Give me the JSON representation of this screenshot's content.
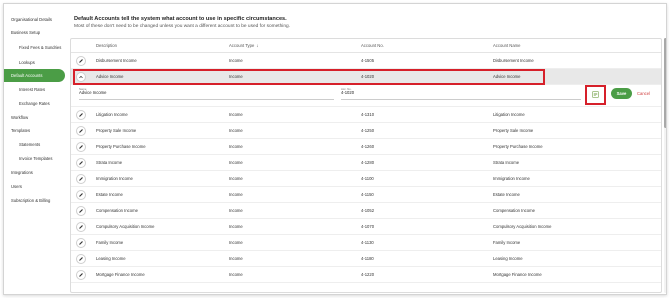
{
  "sidebar": {
    "items": [
      {
        "label": "Organisational Details",
        "level": "top",
        "active": false
      },
      {
        "label": "Business Setup",
        "level": "top",
        "active": false
      },
      {
        "label": "Fixed Fees & Sundries",
        "level": "sub",
        "active": false
      },
      {
        "label": "Lookups",
        "level": "sub",
        "active": false
      },
      {
        "label": "Default Accounts",
        "level": "top",
        "active": true
      },
      {
        "label": "Interest Rates",
        "level": "sub",
        "active": false
      },
      {
        "label": "Exchange Rates",
        "level": "sub",
        "active": false
      },
      {
        "label": "Workflow",
        "level": "top",
        "active": false
      },
      {
        "label": "Templates",
        "level": "top",
        "active": false
      },
      {
        "label": "Statements",
        "level": "sub",
        "active": false
      },
      {
        "label": "Invoice Templates",
        "level": "sub",
        "active": false
      },
      {
        "label": "Integrations",
        "level": "top",
        "active": false
      },
      {
        "label": "Users",
        "level": "top",
        "active": false
      },
      {
        "label": "Subscription & Billing",
        "level": "top",
        "active": false
      }
    ]
  },
  "intro": {
    "line1": "Default Accounts tell the system what account to use in specific circumstances.",
    "line2": "Most of these don't need to be changed unless you want a different account to be used for something."
  },
  "table": {
    "headers": {
      "description": "Description",
      "account_type": "Account Type",
      "sort_glyph": "↓",
      "account_no": "Account No.",
      "account_name": "Account Name"
    },
    "rows_before": [
      {
        "description": "Disbursement Income",
        "type": "Income",
        "no": "4-1505",
        "name": "Disbursement Income"
      }
    ],
    "expanded_row": {
      "description": "Advice Income",
      "type": "Income",
      "no": "4-1020",
      "name": "Advice Income"
    },
    "edit": {
      "name_label": "Name",
      "name_value": "Advice Income",
      "acc_label": "Acc. No.",
      "acc_value": "4-1020",
      "save_label": "Save",
      "cancel_label": "Cancel"
    },
    "rows_after": [
      {
        "description": "Litigation Income",
        "type": "Income",
        "no": "4-1310",
        "name": "Litigation Income"
      },
      {
        "description": "Property Sale Income",
        "type": "Income",
        "no": "4-1250",
        "name": "Property Sale Income"
      },
      {
        "description": "Property Purchase Income",
        "type": "Income",
        "no": "4-1260",
        "name": "Property Purchase Income"
      },
      {
        "description": "Strata Income",
        "type": "Income",
        "no": "4-1280",
        "name": "Strata Income"
      },
      {
        "description": "Immigration Income",
        "type": "Income",
        "no": "4-1100",
        "name": "Immigration Income"
      },
      {
        "description": "Estate Income",
        "type": "Income",
        "no": "4-1150",
        "name": "Estate Income"
      },
      {
        "description": "Compensation Income",
        "type": "Income",
        "no": "4-1052",
        "name": "Compensation Income"
      },
      {
        "description": "Compulsory Acquisition Income",
        "type": "Income",
        "no": "4-1070",
        "name": "Compulsory Acquisition Income"
      },
      {
        "description": "Family Income",
        "type": "Income",
        "no": "4-1130",
        "name": "Family Income"
      },
      {
        "description": "Leasing Income",
        "type": "Income",
        "no": "4-1180",
        "name": "Leasing Income"
      },
      {
        "description": "Mortgage Finance Income",
        "type": "Income",
        "no": "4-1220",
        "name": "Mortgage Finance Income"
      }
    ]
  },
  "colors": {
    "accent": "#4b9d46",
    "highlight": "#d6202a",
    "cancel": "#d04040"
  },
  "icons": {
    "row_edit": "pencil-icon",
    "row_collapse": "chevron-up-icon",
    "account_picker": "account-list-icon"
  }
}
